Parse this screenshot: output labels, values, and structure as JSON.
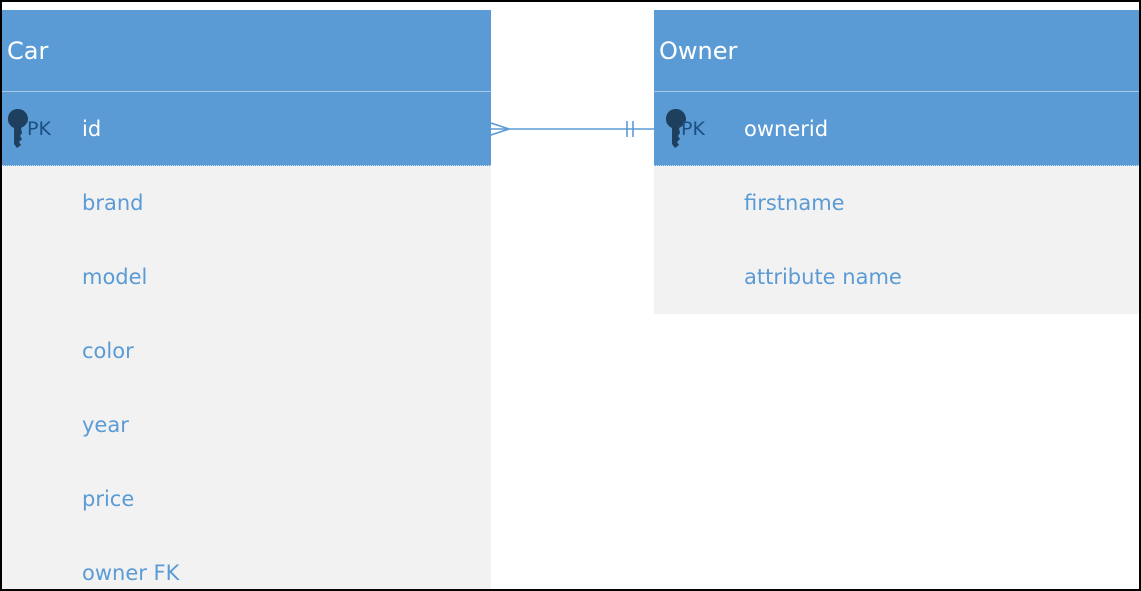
{
  "colors": {
    "header": "#5b9bd5",
    "body": "#f2f2f2",
    "pk_label": "#1c4f80",
    "attribute_text": "#5b9bd5",
    "key_icon": "#1f3f5e",
    "connector": "#5b9bd5"
  },
  "car": {
    "title": "Car",
    "pk_label": "PK",
    "pk_name": "id",
    "attributes": [
      "brand",
      "model",
      "color",
      "year",
      "price",
      "owner FK"
    ]
  },
  "owner": {
    "title": "Owner",
    "pk_label": "PK",
    "pk_name": "ownerid",
    "attributes": [
      "firstname",
      "attribute name"
    ]
  },
  "relationship": {
    "from": "Car",
    "to": "Owner",
    "from_end": "crow-foot (many)",
    "to_end": "double bar (one and only one)"
  },
  "icons": {
    "key": "key-icon"
  }
}
